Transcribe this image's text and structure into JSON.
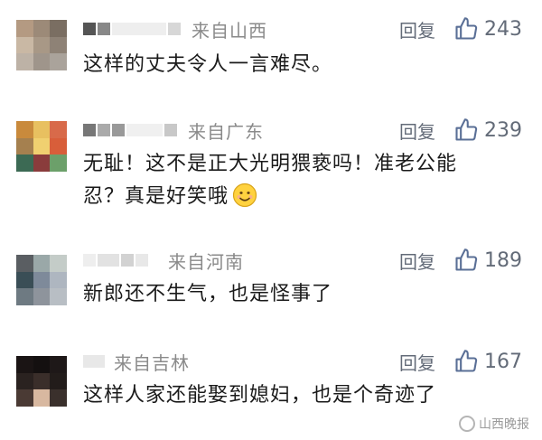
{
  "comments": [
    {
      "location": "来自山西",
      "reply_label": "回复",
      "likes": "243",
      "text": "这样的丈夫令人一言难尽。"
    },
    {
      "location": "来自广东",
      "reply_label": "回复",
      "likes": "239",
      "text_line1": "无耻！这不是正大光明猥亵吗！准老公能",
      "text_line2": "忍？真是好笑哦"
    },
    {
      "location": "来自河南",
      "reply_label": "回复",
      "likes": "189",
      "text": "新郎还不生气，也是怪事了"
    },
    {
      "location": "来自吉林",
      "reply_label": "回复",
      "likes": "167",
      "text": "这样人家还能娶到媳妇，也是个奇迹了"
    }
  ],
  "watermark": "山西晚报",
  "icons": {
    "like": "thumbs-up-icon",
    "emoji": "smiling-face-icon"
  },
  "colors": {
    "location_gray": "#8a8a8a",
    "action_gray": "#636b78",
    "like_icon_blue": "#5a6f96"
  }
}
